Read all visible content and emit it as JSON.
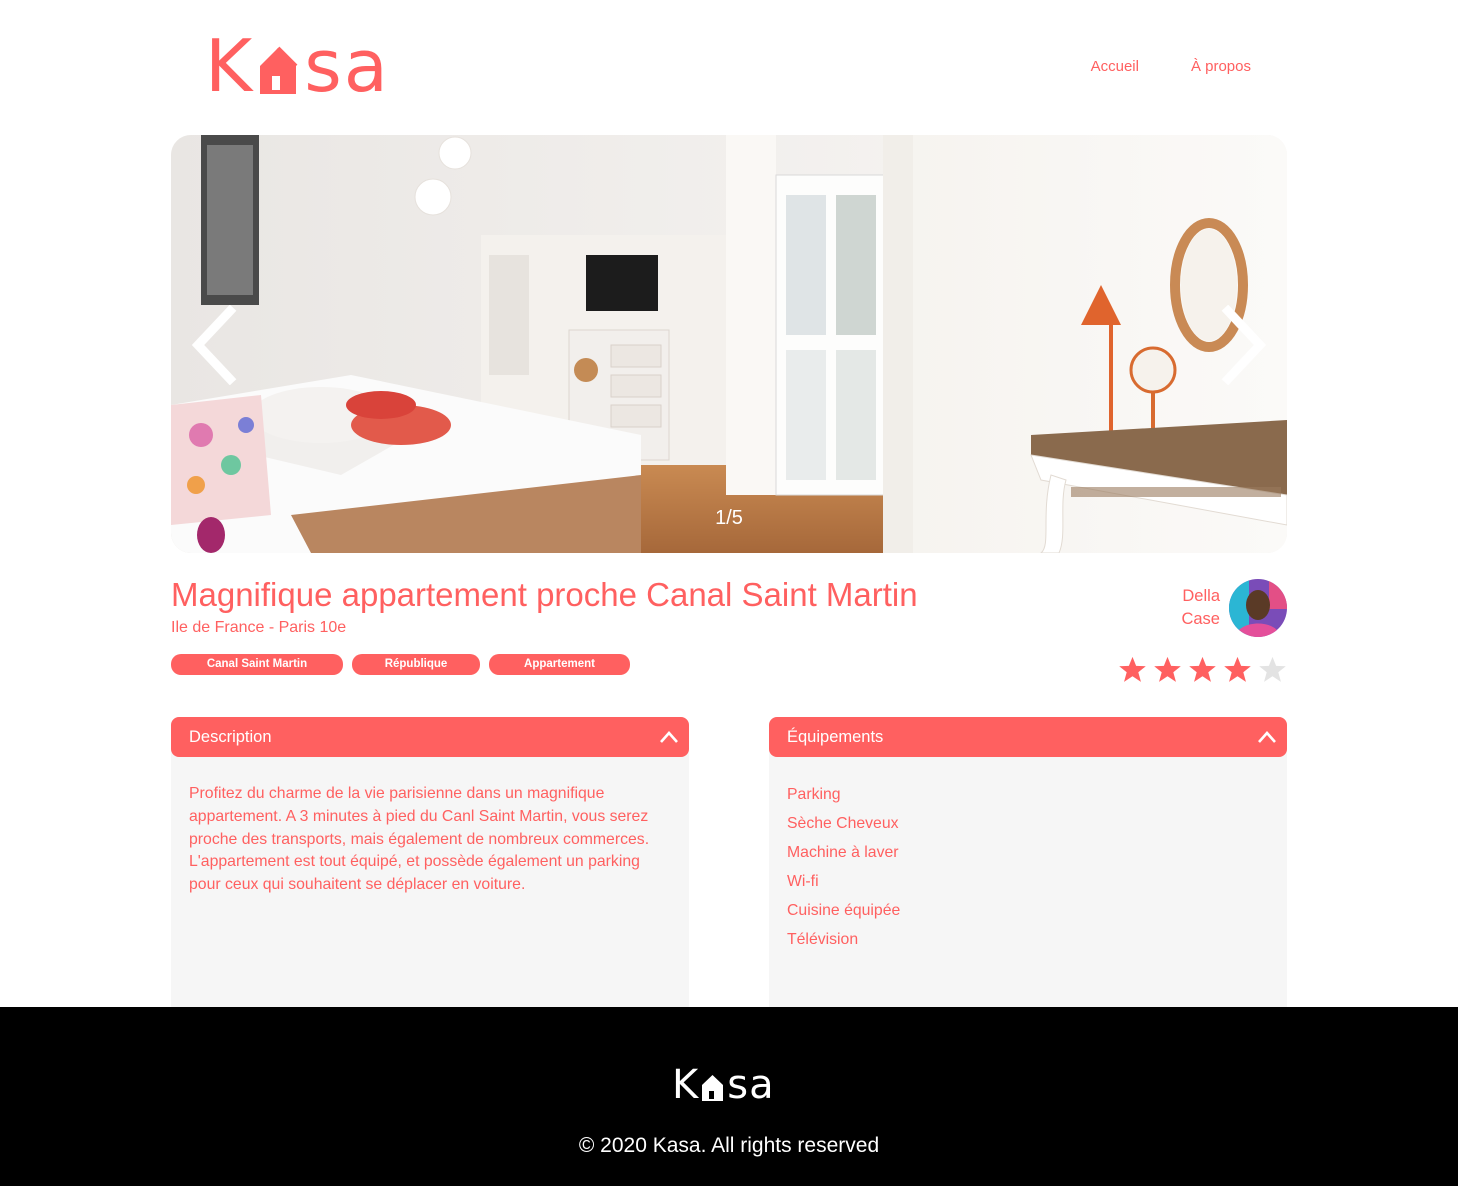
{
  "header": {
    "logo_k": "K",
    "logo_sa": "sa",
    "nav": [
      {
        "label": "Accueil"
      },
      {
        "label": "À propos"
      }
    ]
  },
  "carousel": {
    "counter": "1/5",
    "arrow_prev_icon": "chevron-left-icon",
    "arrow_next_icon": "chevron-right-icon"
  },
  "listing": {
    "title": "Magnifique appartement proche Canal Saint Martin",
    "location": "Ile de France - Paris 10e",
    "tags": [
      "Canal Saint Martin",
      "République",
      "Appartement"
    ],
    "host": {
      "first_name": "Della",
      "last_name": "Case"
    },
    "rating": 4,
    "rating_max": 5
  },
  "description": {
    "title": "Description",
    "text": "Profitez du charme de la vie parisienne dans un magnifique appartement. A 3 minutes à pied du Canl Saint Martin, vous serez proche des transports, mais également de nombreux commerces. L'appartement est tout équipé, et possède également un parking pour ceux qui souhaitent se déplacer en voiture."
  },
  "equipments": {
    "title": "Équipements",
    "items": [
      "Parking",
      "Sèche Cheveux",
      "Machine à laver",
      "Wi-fi",
      "Cuisine équipée",
      "Télévision"
    ]
  },
  "footer": {
    "logo_k": "K",
    "logo_sa": "sa",
    "copyright": "© 2020 Kasa. All rights reserved"
  },
  "colors": {
    "primary": "#FF6060",
    "background_light": "#F6F6F6",
    "footer_bg": "#000000",
    "star_off": "#E3E3E3"
  }
}
